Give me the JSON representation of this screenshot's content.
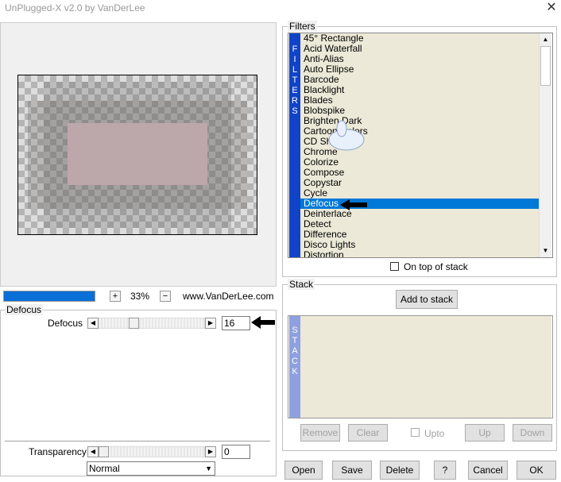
{
  "window": {
    "title": "UnPlugged-X v2.0 by VanDerLee",
    "close_glyph": "✕"
  },
  "preview": {
    "zoom_plus": "+",
    "zoom_value": "33%",
    "zoom_minus": "−",
    "website": "www.VanDerLee.com",
    "progress": 1.0
  },
  "filter_panel": {
    "group_label": "Defocus",
    "param_label": "Defocus",
    "param_value": "16",
    "transparency_label": "Transparency",
    "transparency_value": "0",
    "blend_mode": "Normal",
    "arrow_left": "◀",
    "arrow_right": "▶",
    "dropdown_glyph": "▼"
  },
  "filters": {
    "group_label": "Filters",
    "side_letters": [
      "F",
      "I",
      "L",
      "T",
      "E",
      "R",
      "S"
    ],
    "items": [
      "45° Rectangle",
      "Acid Waterfall",
      "Anti-Alias",
      "Auto Ellipse",
      "Barcode",
      "Blacklight",
      "Blades",
      "Blobspike",
      "Brighten Dark",
      "Cartoon Colors",
      "CD Shine",
      "Chrome",
      "Colorize",
      "Compose",
      "Copystar",
      "Cycle",
      "Defocus",
      "Deinterlace",
      "Detect",
      "Difference",
      "Disco Lights",
      "Distortion"
    ],
    "selected": "Defocus",
    "on_top_label": "On top of stack",
    "scroll_up": "▲",
    "scroll_down": "▼"
  },
  "stack": {
    "group_label": "Stack",
    "add_button": "Add to stack",
    "side_letters": [
      "S",
      "T",
      "A",
      "C",
      "K"
    ],
    "remove": "Remove",
    "clear": "Clear",
    "upto": "Upto",
    "up": "Up",
    "down": "Down"
  },
  "footer": {
    "open": "Open",
    "save": "Save",
    "delete": "Delete",
    "help": "?",
    "cancel": "Cancel",
    "ok": "OK"
  },
  "colors": {
    "accent": "#0078d7",
    "filter_bar": "#1043c8",
    "list_bg": "#ece9d8"
  }
}
